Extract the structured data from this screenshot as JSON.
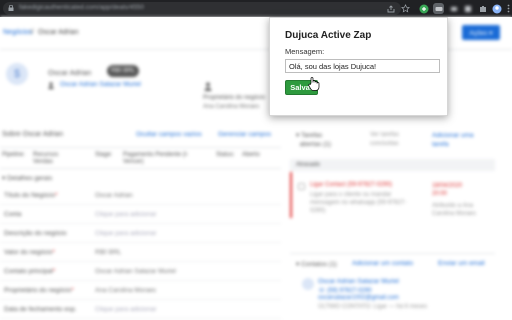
{
  "browser": {
    "url": "fakedigicauthenticated.com/app/deals/4550"
  },
  "page": {
    "breadcrumb_root": "Negócios",
    "breadcrumb_sep": "//",
    "breadcrumb_current": "Oscar Adrian",
    "actions_label": "Ações ▾",
    "deal_name": "Oscar Adrian",
    "deal_value": "R$0 BRL",
    "contact_person": "Oscar Adrian Salazar Muriel",
    "owner_label": "Proprietário do negócio",
    "owner_value": "Ana Carolina Moraes"
  },
  "about": {
    "title": "Sobre Oscar Adrian",
    "hide_empty_link": "Ocultar campos vazios",
    "manage_fields_link": "Gerenciar campos",
    "pipeline_label": "Pipeline:",
    "pipeline_value": "Recursos Vendas",
    "stage_label": "Stage:",
    "stage_value": "Pagamento Pendente (I-Vencer)",
    "status_label": "Status:",
    "status_value": "Aberto",
    "section_title": "Detalhes gerais",
    "fields": [
      {
        "label": "Título do Negócio",
        "required": true,
        "value": "Oscar Adrian",
        "placeholder": false
      },
      {
        "label": "Conta",
        "required": false,
        "value": "Clique para adicionar",
        "placeholder": true
      },
      {
        "label": "Descrição do negócio",
        "required": false,
        "value": "Clique para adicionar",
        "placeholder": true
      },
      {
        "label": "Valor do negócio",
        "required": true,
        "value": "R$0 BRL",
        "placeholder": false
      },
      {
        "label": "Contato principal",
        "required": true,
        "value": "Oscar Adrian Salazar Muriel",
        "placeholder": false
      },
      {
        "label": "Proprietário do negócio",
        "required": true,
        "value": "Ana Carolina Moraes",
        "placeholder": false
      },
      {
        "label": "Data de fechamento esp.",
        "required": false,
        "value": "Clique para adicionar",
        "placeholder": true
      }
    ]
  },
  "tasks": {
    "title_line1": "Tarefas",
    "title_line2": "abertas (1)",
    "col2_line1": "Ver tarefas",
    "col2_line2": "concluídas",
    "add_line1": "Adicionar uma",
    "add_line2": "tarefa",
    "overdue_label": "Atrasado",
    "task_title": "Ligar Contact (59-97827-0290)",
    "task_desc": "Ligar para o cliente ou mandar mensagem no whatsapp (59-97827-0290)",
    "task_date_line1": "18/04/2020",
    "task_date_line2": "20:00",
    "task_assign_line1": "Atribuído a Ana",
    "task_assign_line2": "Carolina Moraes"
  },
  "contacts": {
    "title": "Contatos (1)",
    "add_link": "Adicionar um contato",
    "email_link": "Enviar um email",
    "name": "Oscar Adrian Salazar Muriel",
    "phone": "(59) 97827-0290",
    "email": "oscarsalazar1002@gmail.com",
    "last_contact": "ÚLTIMO CONTATO: Ligar — há 6 meses"
  },
  "popup": {
    "title": "Dujuca Active Zap",
    "message_label": "Mensagem:",
    "message_value": "Olá, sou das lojas Dujuca!",
    "send_label": "Salvar"
  },
  "colors": {
    "accent": "#1a6bd6",
    "save_green": "#2e9a3e",
    "overdue_red": "#e23a3a"
  }
}
